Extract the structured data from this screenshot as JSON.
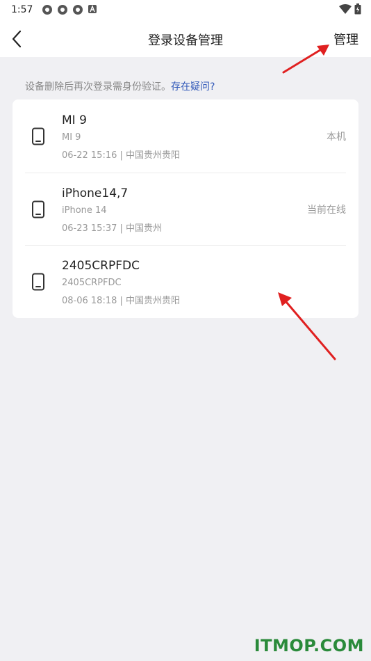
{
  "status_bar": {
    "time": "1:57"
  },
  "header": {
    "title": "登录设备管理",
    "manage_label": "管理"
  },
  "hint": {
    "text": "设备删除后再次登录需身份验证。",
    "link": "存在疑问?"
  },
  "devices": [
    {
      "name": "MI 9",
      "model": "MI 9",
      "time": "06-22 15:16 | 中国贵州贵阳",
      "status": "本机"
    },
    {
      "name": "iPhone14,7",
      "model": "iPhone 14",
      "time": "06-23 15:37 | 中国贵州",
      "status": "当前在线"
    },
    {
      "name": "2405CRPFDC",
      "model": "2405CRPFDC",
      "time": "08-06 18:18 | 中国贵州贵阳",
      "status": ""
    }
  ],
  "watermark": "ITMOP.COM",
  "colors": {
    "link": "#2f57b8",
    "annotation_arrow": "#e02020",
    "watermark": "#2a8a3a"
  }
}
